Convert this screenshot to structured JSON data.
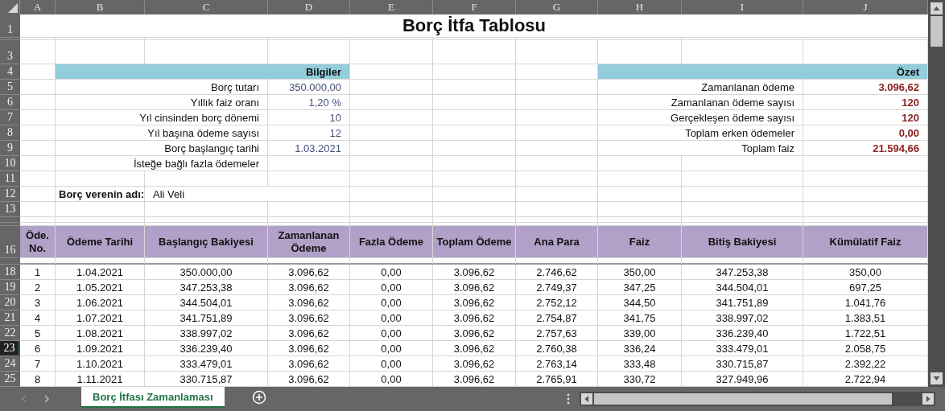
{
  "column_headers": [
    "A",
    "B",
    "C",
    "D",
    "E",
    "F",
    "G",
    "H",
    "I",
    "J"
  ],
  "row_numbers": [
    {
      "label": "1",
      "selected": false
    },
    {
      "label": "3",
      "selected": false
    },
    {
      "label": "4",
      "selected": false
    },
    {
      "label": "5",
      "selected": false
    },
    {
      "label": "6",
      "selected": false
    },
    {
      "label": "7",
      "selected": false
    },
    {
      "label": "8",
      "selected": false
    },
    {
      "label": "9",
      "selected": false
    },
    {
      "label": "10",
      "selected": false
    },
    {
      "label": "11",
      "selected": false
    },
    {
      "label": "12",
      "selected": false
    },
    {
      "label": "13",
      "selected": false
    },
    {
      "label": "16",
      "selected": false
    },
    {
      "label": "18",
      "selected": false
    },
    {
      "label": "19",
      "selected": false
    },
    {
      "label": "20",
      "selected": false
    },
    {
      "label": "21",
      "selected": false
    },
    {
      "label": "22",
      "selected": false
    },
    {
      "label": "23",
      "selected": true
    },
    {
      "label": "24",
      "selected": false
    },
    {
      "label": "25",
      "selected": false
    }
  ],
  "title": "Borç İtfa Tablosu",
  "info": {
    "header": "Bilgiler",
    "rows": [
      {
        "label": "Borç tutarı",
        "value": "350.000,00"
      },
      {
        "label": "Yıllık faiz oranı",
        "value": "1,20  %"
      },
      {
        "label": "Yıl cinsinden borç dönemi",
        "value": "10"
      },
      {
        "label": "Yıl başına ödeme sayısı",
        "value": "12"
      },
      {
        "label": "Borç başlangıç tarihi",
        "value": "1.03.2021"
      },
      {
        "label": "İsteğe bağlı fazla ödemeler"
      }
    ]
  },
  "summary": {
    "header": "Özet",
    "rows": [
      {
        "label": "Zamanlanan ödeme",
        "value": "3.096,62"
      },
      {
        "label": "Zamanlanan ödeme sayısı",
        "value": "120"
      },
      {
        "label": "Gerçekleşen ödeme sayısı",
        "value": "120"
      },
      {
        "label": "Toplam erken ödemeler",
        "value": "0,00"
      },
      {
        "label": "Toplam faiz",
        "value": "21.594,66"
      }
    ]
  },
  "lender": {
    "label": "Borç verenin adı:",
    "value": "Ali Veli"
  },
  "schedule": {
    "columns": [
      "Öde. No.",
      "Ödeme Tarihi",
      "Başlangıç Bakiyesi",
      "Zamanlanan Ödeme",
      "Fazla Ödeme",
      "Toplam Ödeme",
      "Ana Para",
      "Faiz",
      "Bitiş Bakiyesi",
      "Kümülatif Faiz"
    ],
    "rows": [
      [
        "1",
        "1.04.2021",
        "350.000,00",
        "3.096,62",
        "0,00",
        "3.096,62",
        "2.746,62",
        "350,00",
        "347.253,38",
        "350,00"
      ],
      [
        "2",
        "1.05.2021",
        "347.253,38",
        "3.096,62",
        "0,00",
        "3.096,62",
        "2.749,37",
        "347,25",
        "344.504,01",
        "697,25"
      ],
      [
        "3",
        "1.06.2021",
        "344.504,01",
        "3.096,62",
        "0,00",
        "3.096,62",
        "2.752,12",
        "344,50",
        "341.751,89",
        "1.041,76"
      ],
      [
        "4",
        "1.07.2021",
        "341.751,89",
        "3.096,62",
        "0,00",
        "3.096,62",
        "2.754,87",
        "341,75",
        "338.997,02",
        "1.383,51"
      ],
      [
        "5",
        "1.08.2021",
        "338.997,02",
        "3.096,62",
        "0,00",
        "3.096,62",
        "2.757,63",
        "339,00",
        "336.239,40",
        "1.722,51"
      ],
      [
        "6",
        "1.09.2021",
        "336.239,40",
        "3.096,62",
        "0,00",
        "3.096,62",
        "2.760,38",
        "336,24",
        "333.479,01",
        "2.058,75"
      ],
      [
        "7",
        "1.10.2021",
        "333.479,01",
        "3.096,62",
        "0,00",
        "3.096,62",
        "2.763,14",
        "333,48",
        "330.715,87",
        "2.392,22"
      ],
      [
        "8",
        "1.11.2021",
        "330.715,87",
        "3.096,62",
        "0,00",
        "3.096,62",
        "2.765,91",
        "330,72",
        "327.949,96",
        "2.722,94"
      ]
    ]
  },
  "sheet_tabs": [
    {
      "label": "Borç İtfası Zamanlaması",
      "selected": true
    }
  ]
}
